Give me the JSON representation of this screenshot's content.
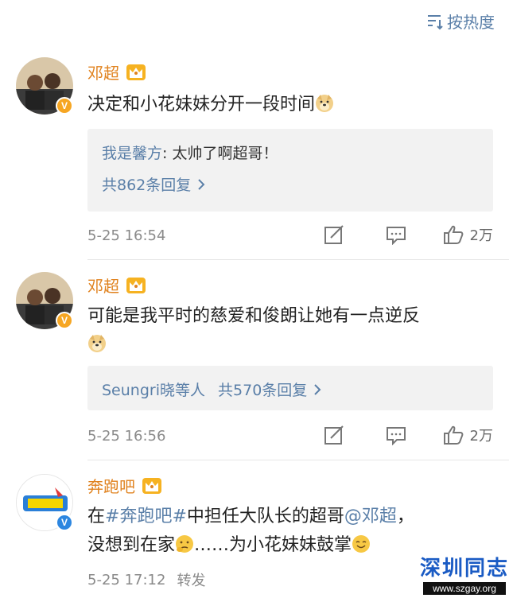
{
  "sort": {
    "label": "按热度"
  },
  "comments": [
    {
      "name": "邓超",
      "text": "决定和小花妹妹分开一段时间",
      "reply_user": "我是馨方",
      "reply_text": ": 太帅了啊超哥！",
      "reply_count": "共862条回复",
      "time": "5-25 16:54",
      "likes": "2万"
    },
    {
      "name": "邓超",
      "text_line1": "可能是我平时的慈爱和俊朗让她有一点逆反",
      "reply_user": "Seungri晓等人",
      "reply_count": "共570条回复",
      "time": "5-25 16:56",
      "likes": "2万"
    },
    {
      "name": "奔跑吧",
      "text_parts": {
        "p1": "在",
        "tag": "#奔跑吧#",
        "p2": "中担任大队长的超哥",
        "mention": "@邓超",
        "p3": "，",
        "line2a": "没想到在家",
        "line2b": "……为小花妹妹鼓掌"
      },
      "time": "5-25 17:12",
      "repost": "转发"
    }
  ],
  "watermark": {
    "top": "深圳同志",
    "bottom": "www.szgay.org"
  },
  "colors": {
    "link": "#5a7fa8",
    "name": "#e0821e",
    "reply_bg": "#f2f2f2"
  }
}
